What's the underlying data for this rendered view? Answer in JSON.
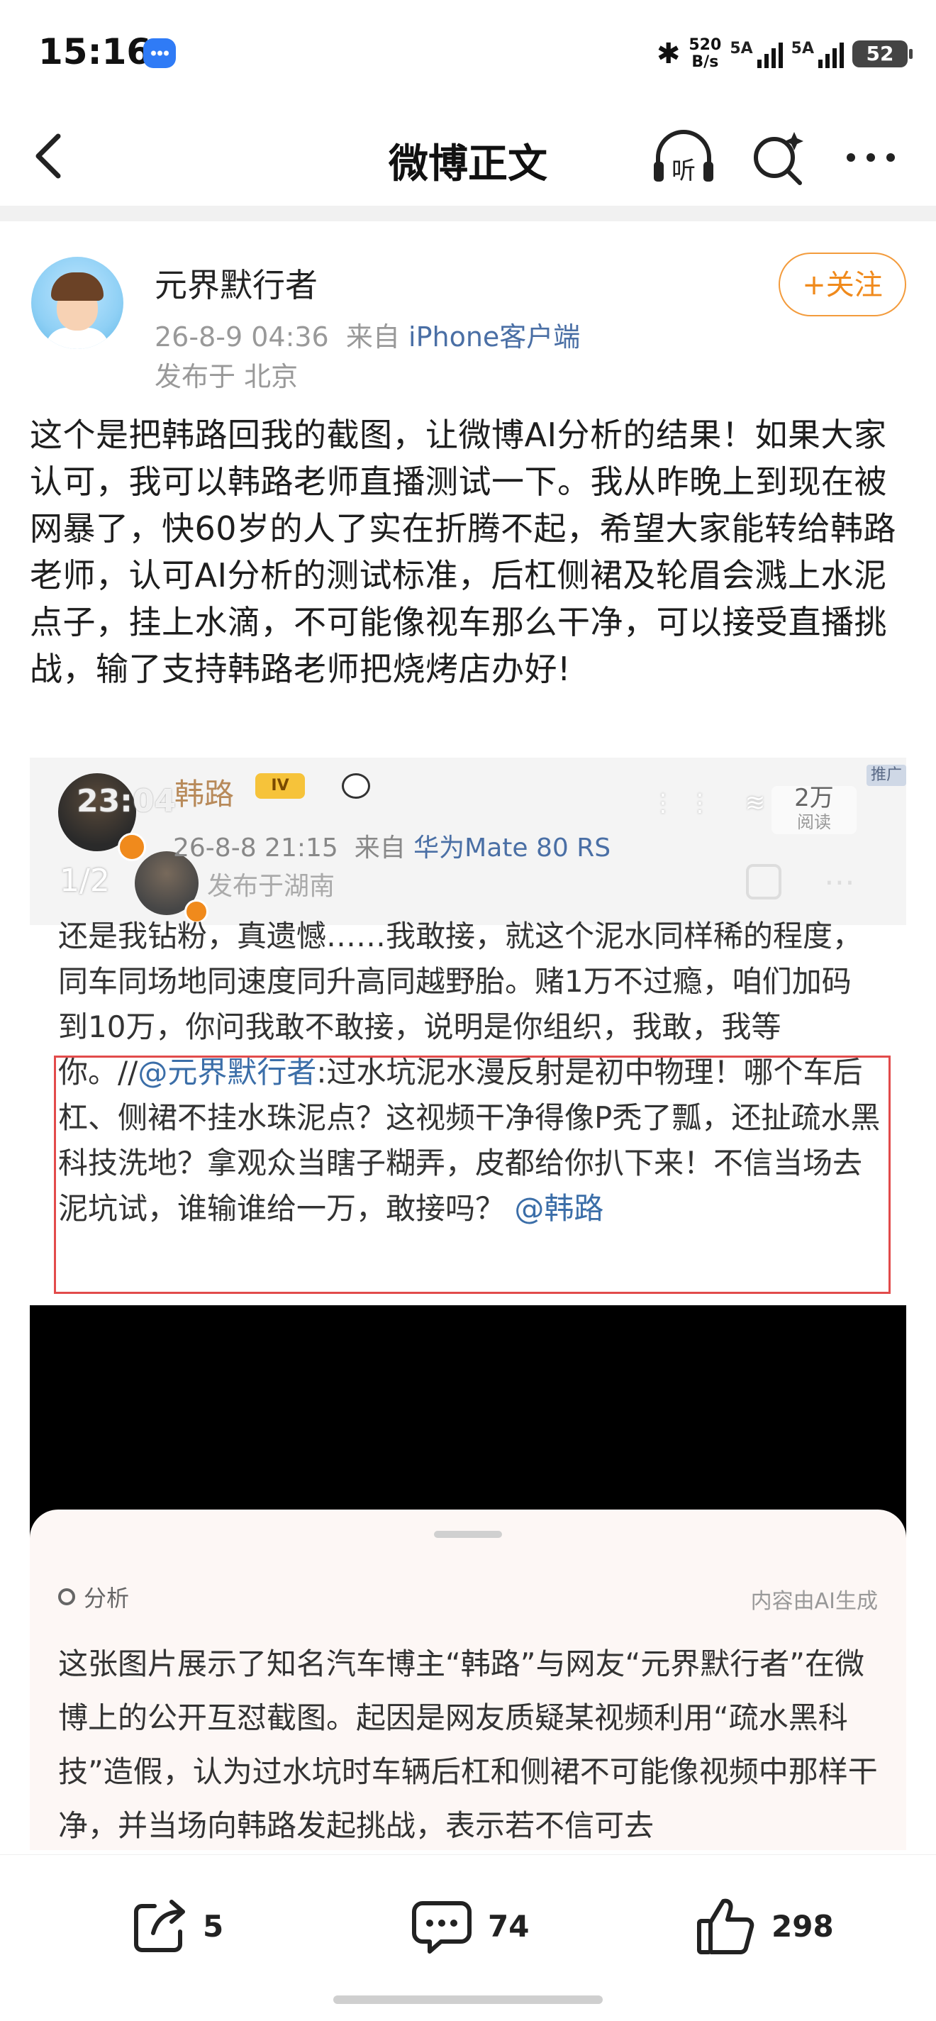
{
  "status_bar": {
    "time": "15:16",
    "net_speed": "520",
    "net_unit": "B/s",
    "sig1": "5A",
    "sig2": "5A",
    "battery": "52"
  },
  "nav": {
    "title": "微博正文",
    "listen_label": "听"
  },
  "post": {
    "author": "元界默行者",
    "date": "26-8-9 04:36",
    "source_prefix": "来自",
    "client": "iPhone客户端",
    "location": "发布于 北京",
    "follow_label": "+关注",
    "text": "这个是把韩路回我的截图，让微博AI分析的结果！如果大家认可，我可以韩路老师直播测试一下。我从昨晚上到现在被网暴了，快60岁的人了实在折腾不起，希望大家能转给韩路老师，认可AI分析的测试标准，后杠侧裙及轮眉会溅上水泥点子，挂上水滴，不可能像视车那么干净，可以接受直播挑战，输了支持韩路老师把烧烤店办好!"
  },
  "embedded": {
    "time": "23:04",
    "user": "韩路",
    "crown_label": "IV",
    "date": "26-8-8 21:15",
    "source_prefix": "来自",
    "client": "华为Mate 80 RS",
    "location": "发布于湖南",
    "index": "1/2",
    "reads": "2万",
    "reads_label": "阅读",
    "promo": "推广",
    "text_part1": "还是我钻粉，真遗憾……我敢接，就这个泥水同样稀的程度，同车同场地同速度同升高同越野胎。赌1万不过瘾，咱们加码到10万，你问我敢不敢接，说明是你组织，我敢，我等你。//",
    "mention1": "@元界默行者",
    "text_part2": ":过水坑泥水漫反射是初中物理！哪个车后杠、侧裙不挂水珠泥点？这视频干净得像P秃了瓢，还扯疏水黑科技洗地？拿观众当瞎子糊弄，皮都给你扒下来！不信当场去泥坑试，谁输谁给一万，敢接吗？",
    "mention2": "@韩路",
    "ai": {
      "label": "分析",
      "note": "内容由AI生成",
      "text": "这张图片展示了知名汽车博主“韩路”与网友“元界默行者”在微博上的公开互怼截图。起因是网友质疑某视频利用“疏水黑科技”造假，认为过水坑时车辆后杠和侧裙不可能像视频中那样干净，并当场向韩路发起挑战，表示若不信可去"
    }
  },
  "actions": {
    "share_count": "5",
    "comment_count": "74",
    "like_count": "298"
  },
  "colors": {
    "accent_orange": "#f08a1c",
    "link_blue": "#3b6ea8",
    "highlight_red": "#e24b4b"
  }
}
